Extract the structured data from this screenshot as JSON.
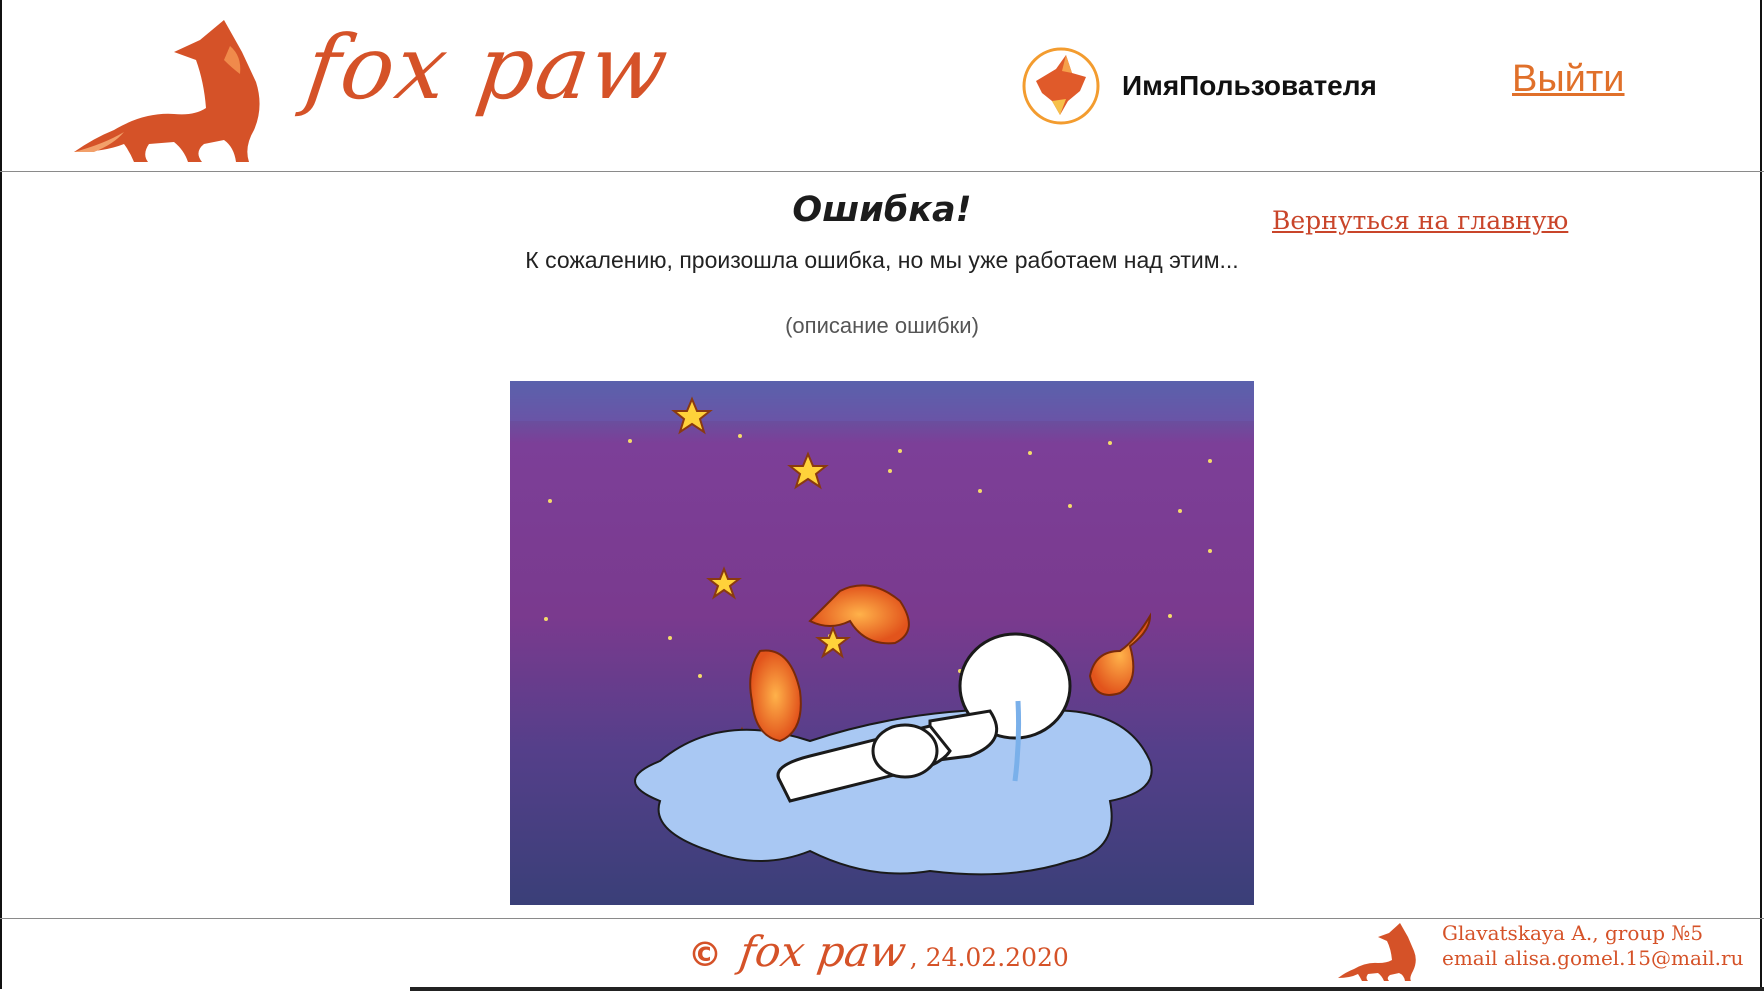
{
  "header": {
    "brand_name": "fox paw",
    "username": "ИмяПользователя",
    "logout_label": "Выйти"
  },
  "main": {
    "title": "Ошибка!",
    "message": "К сожалению, произошла ошибка, но мы уже работаем над этим...",
    "description": "(описание ошибки)",
    "back_link": "Вернуться на главную"
  },
  "footer": {
    "copyright_symbol": "©",
    "brand_name": "fox paw",
    "date": ", 24.02.2020",
    "author": "Glavatskaya A., group №5",
    "email": "email  alisa.gomel.15@mail.ru"
  },
  "colors": {
    "brand": "#d55228",
    "link": "#c9452a",
    "logout": "#e0702a",
    "sky_top": "#7a3fa0",
    "sky_bottom": "#3e3d7a",
    "puddle": "#a8c8f2"
  },
  "icons": {
    "logo": "fox-logo-icon",
    "avatar": "fox-avatar-icon",
    "footer_logo": "fox-small-icon",
    "copyright": "copyright-icon"
  }
}
